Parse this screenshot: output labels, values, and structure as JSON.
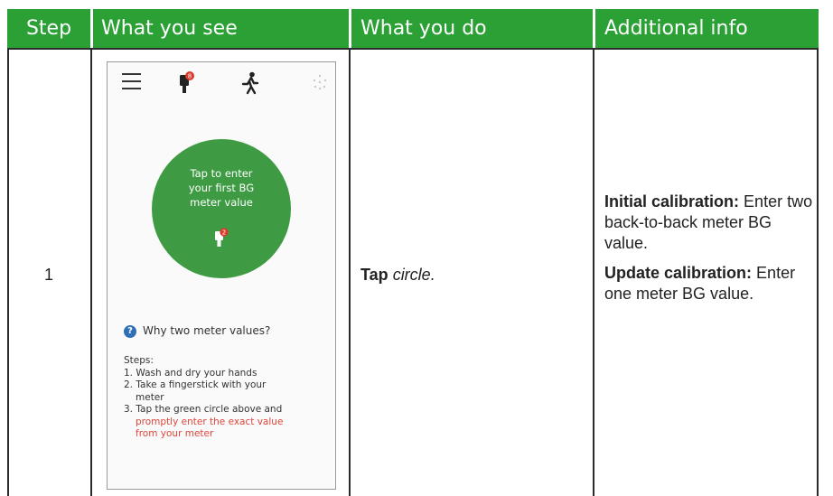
{
  "table": {
    "headers": {
      "step": "Step",
      "see": "What you see",
      "do": "What you do",
      "info": "Additional info"
    },
    "row": {
      "step": "1",
      "do": {
        "action": "Tap",
        "target": "circle."
      },
      "info": {
        "initial_label": "Initial calibration:",
        "initial_text": "Enter two back-to-back meter BG value.",
        "update_label": "Update calibration:",
        "update_text": "Enter one meter BG value."
      }
    }
  },
  "phone": {
    "icons": [
      "menu-icon",
      "meter-icon",
      "running-person-icon",
      "sensor-dots-icon"
    ],
    "meter_badge": "8",
    "circle_lines": [
      "Tap to enter",
      "your first BG",
      "meter value"
    ],
    "circle_badge": "2",
    "why_text": "Why two meter values?",
    "steps_title": "Steps:",
    "step1": "1. Wash and dry your hands",
    "step2a": "2. Take a fingerstick with your",
    "step2b": "meter",
    "step3a": "3. Tap the green circle above and",
    "step3b": "promptly enter the exact value",
    "step3c": "from your meter"
  },
  "colors": {
    "header_green": "#2aa035",
    "circle_green": "#3e9b43",
    "warning_red": "#e0453b",
    "help_blue": "#2f6fb5"
  }
}
